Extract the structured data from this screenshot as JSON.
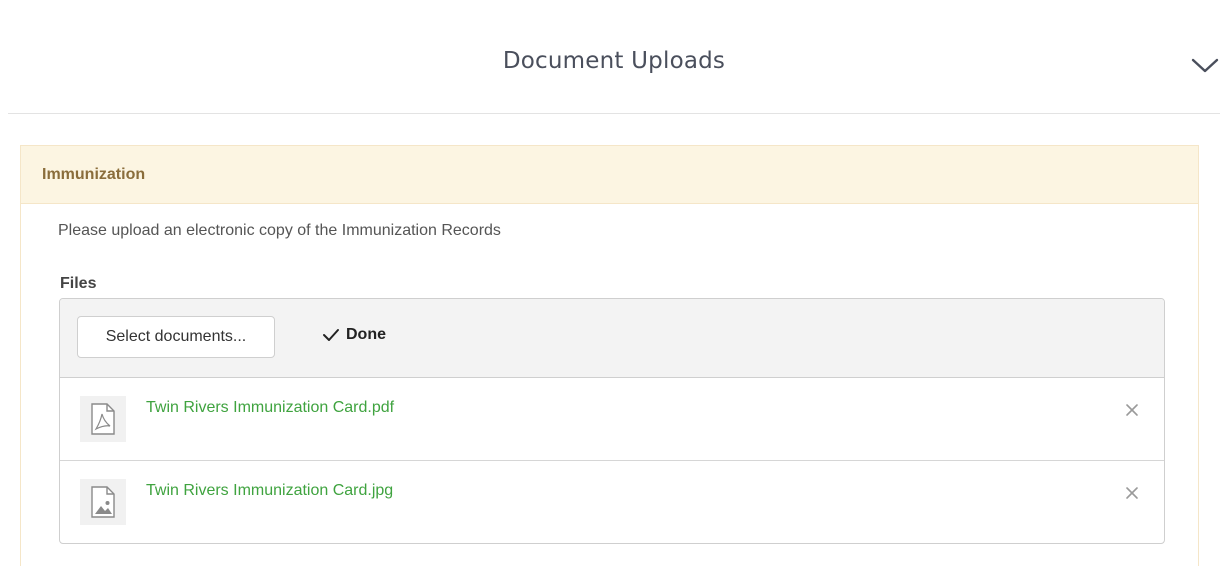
{
  "header": {
    "title": "Document Uploads",
    "collapse_icon": "chevron-down-icon"
  },
  "panel": {
    "heading": "Immunization",
    "description": "Please upload an electronic copy of the Immunization Records",
    "files_label": "Files",
    "toolbar": {
      "select_label": "Select documents...",
      "done_label": "Done",
      "done_icon": "checkmark-icon"
    },
    "files": [
      {
        "name": "Twin Rivers Immunization Card.pdf",
        "icon": "pdf-file-icon"
      },
      {
        "name": "Twin Rivers Immunization Card.jpg",
        "icon": "image-file-icon"
      }
    ]
  },
  "colors": {
    "panel_heading_bg": "#fcf5e2",
    "panel_heading_text": "#8a6d3b",
    "file_link": "#3fa33f"
  }
}
